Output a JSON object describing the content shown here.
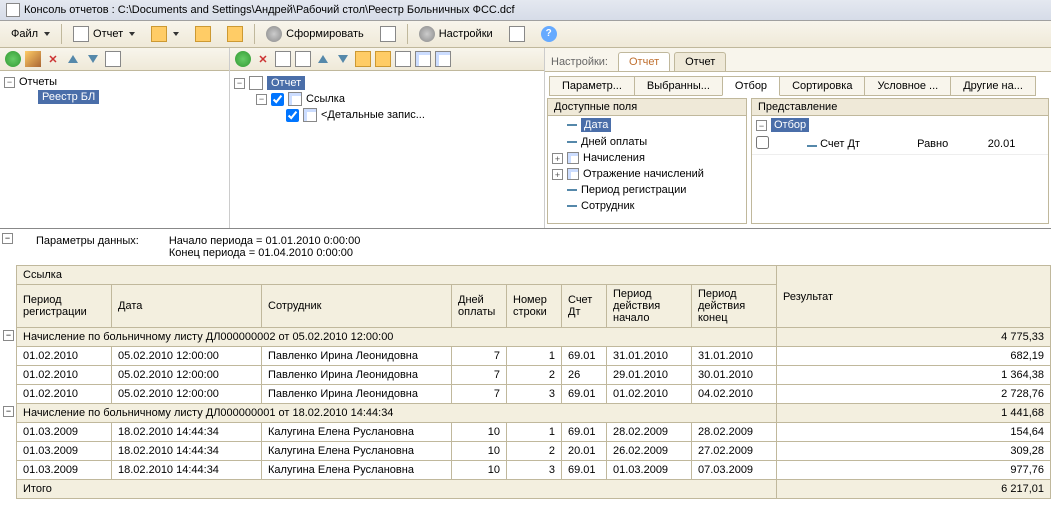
{
  "window": {
    "title": "Консоль отчетов : C:\\Documents and Settings\\Андрей\\Рабочий стол\\Реестр Больничных ФСС.dcf"
  },
  "main_toolbar": {
    "file": "Файл",
    "report": "Отчет",
    "form": "Сформировать",
    "settings": "Настройки"
  },
  "left_tree": {
    "root": "Отчеты",
    "item1": "Реестр БЛ"
  },
  "mid_tree": {
    "root": "Отчет",
    "item1": "Ссылка",
    "item2": "<Детальные запис..."
  },
  "right": {
    "settings_label": "Настройки:",
    "tab1": "Отчет",
    "tab2": "Отчет",
    "subtabs": {
      "t1": "Параметр...",
      "t2": "Выбранны...",
      "t3": "Отбор",
      "t4": "Сортировка",
      "t5": "Условное ...",
      "t6": "Другие на..."
    },
    "fields_header": "Доступные поля",
    "fields": {
      "f1": "Дата",
      "f2": "Дней оплаты",
      "f3": "Начисления",
      "f4": "Отражение начислений",
      "f5": "Период регистрации",
      "f6": "Сотрудник"
    },
    "repr_header": "Представление",
    "filter": {
      "root": "Отбор",
      "field": "Счет Дт",
      "cond": "Равно",
      "val": "20.01"
    }
  },
  "report": {
    "params_label": "Параметры данных:",
    "start": "Начало периода = 01.01.2010 0:00:00",
    "end": "Конец периода = 01.04.2010 0:00:00",
    "col_link": "Ссылка",
    "col_result": "Результат",
    "cols": {
      "c1": "Период регистрации",
      "c2": "Дата",
      "c3": "Сотрудник",
      "c4": "Дней оплаты",
      "c5": "Номер строки",
      "c6": "Счет Дт",
      "c7": "Период действия начало",
      "c8": "Период действия конец"
    },
    "g1": {
      "title": "Начисление по больничному листу ДЛ000000002 от 05.02.2010 12:00:00",
      "total": "4 775,33"
    },
    "r1": {
      "c1": "01.02.2010",
      "c2": "05.02.2010 12:00:00",
      "c3": "Павленко Ирина Леонидовна",
      "c4": "7",
      "c5": "1",
      "c6": "69.01",
      "c7": "31.01.2010",
      "c8": "31.01.2010",
      "res": "682,19"
    },
    "r2": {
      "c1": "01.02.2010",
      "c2": "05.02.2010 12:00:00",
      "c3": "Павленко Ирина Леонидовна",
      "c4": "7",
      "c5": "2",
      "c6": "26",
      "c7": "29.01.2010",
      "c8": "30.01.2010",
      "res": "1 364,38"
    },
    "r3": {
      "c1": "01.02.2010",
      "c2": "05.02.2010 12:00:00",
      "c3": "Павленко Ирина Леонидовна",
      "c4": "7",
      "c5": "3",
      "c6": "69.01",
      "c7": "01.02.2010",
      "c8": "04.02.2010",
      "res": "2 728,76"
    },
    "g2": {
      "title": "Начисление по больничному листу ДЛ000000001 от 18.02.2010 14:44:34",
      "total": "1 441,68"
    },
    "r4": {
      "c1": "01.03.2009",
      "c2": "18.02.2010 14:44:34",
      "c3": "Калугина Елена Руслановна",
      "c4": "10",
      "c5": "1",
      "c6": "69.01",
      "c7": "28.02.2009",
      "c8": "28.02.2009",
      "res": "154,64"
    },
    "r5": {
      "c1": "01.03.2009",
      "c2": "18.02.2010 14:44:34",
      "c3": "Калугина Елена Руслановна",
      "c4": "10",
      "c5": "2",
      "c6": "20.01",
      "c7": "26.02.2009",
      "c8": "27.02.2009",
      "res": "309,28"
    },
    "r6": {
      "c1": "01.03.2009",
      "c2": "18.02.2010 14:44:34",
      "c3": "Калугина Елена Руслановна",
      "c4": "10",
      "c5": "3",
      "c6": "69.01",
      "c7": "01.03.2009",
      "c8": "07.03.2009",
      "res": "977,76"
    },
    "total_label": "Итого",
    "total_value": "6 217,01"
  }
}
